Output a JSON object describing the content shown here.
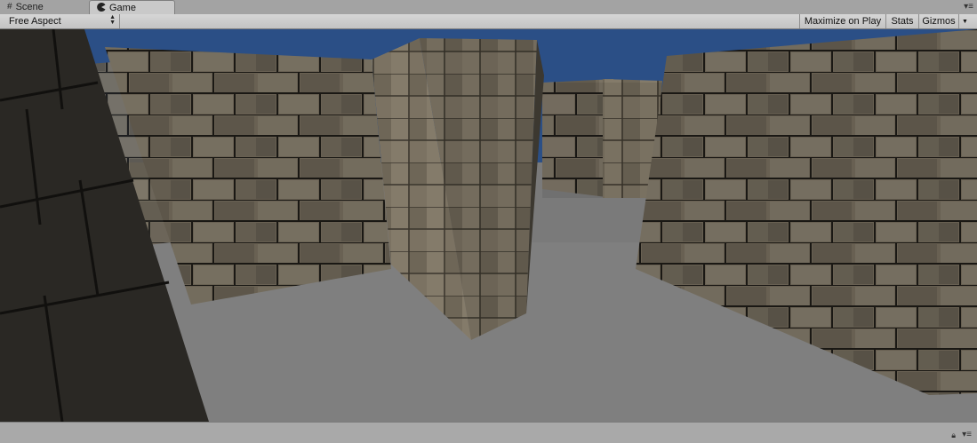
{
  "tabs": [
    {
      "label": "Scene",
      "icon": "grid-icon",
      "active": false
    },
    {
      "label": "Game",
      "icon": "pacman-icon",
      "active": true
    }
  ],
  "toolbar": {
    "aspect": "Free Aspect",
    "maximize": "Maximize on Play",
    "stats": "Stats",
    "gizmos": "Gizmos"
  },
  "viewport": {
    "sky_color": "#2b4f86",
    "floor_color": "#7a7a7a",
    "wall_color": "#6a6254"
  }
}
